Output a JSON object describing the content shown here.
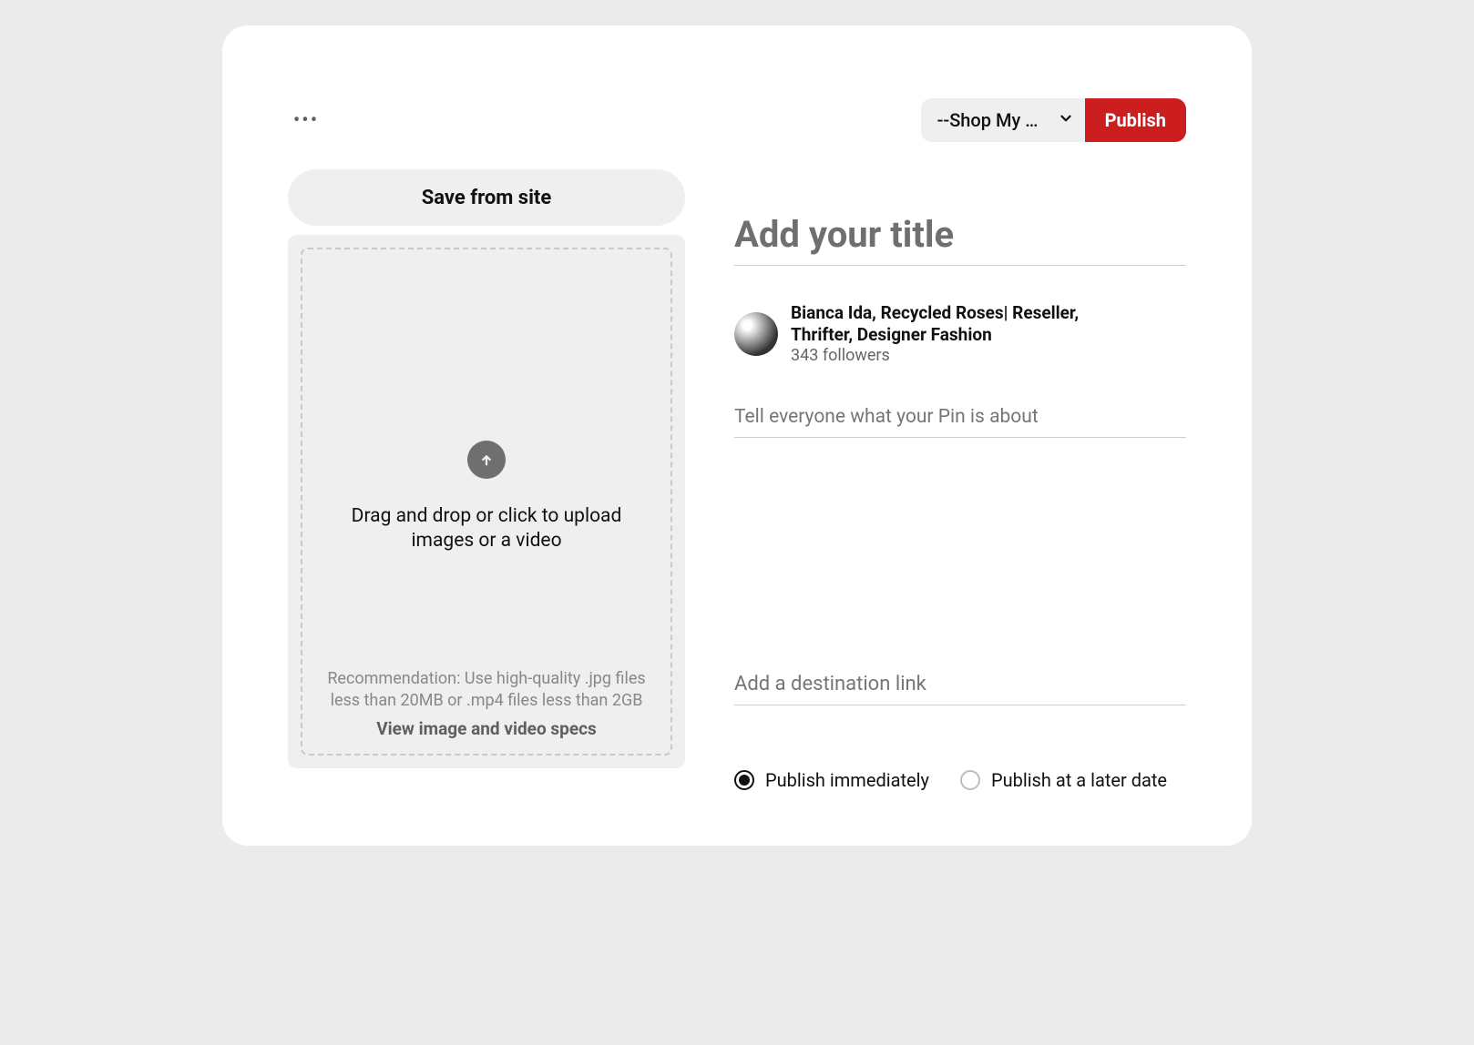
{
  "topbar": {
    "board_selected_label": "--Shop My …",
    "publish_label": "Publish"
  },
  "left": {
    "save_from_site_label": "Save from site",
    "upload_primary_text": "Drag and drop or click to upload images or a video",
    "upload_recommendation_text": "Recommendation: Use high-quality .jpg files less than 20MB or .mp4 files less than 2GB",
    "upload_specs_link_text": "View image and video specs"
  },
  "right": {
    "title_placeholder": "Add your title",
    "user_name": "Bianca Ida, Recycled Roses| Reseller, Thrifter, Designer Fashion",
    "user_followers": "343 followers",
    "description_placeholder": "Tell everyone what your Pin is about",
    "link_placeholder": "Add a destination link",
    "publish_now_label": "Publish immediately",
    "publish_later_label": "Publish at a later date"
  }
}
